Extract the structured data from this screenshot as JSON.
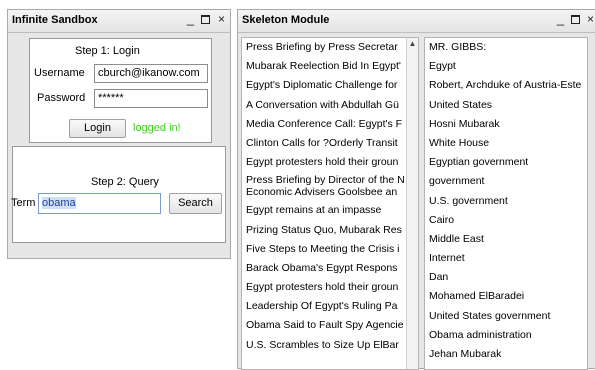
{
  "sandbox": {
    "title": "Infinite Sandbox",
    "min_glyph": "_",
    "close_glyph": "×",
    "step1_title": "Step 1: Login",
    "username_label": "Username",
    "username_value": "cburch@ikanow.com",
    "password_label": "Password",
    "password_value": "******",
    "login_label": "Login",
    "status_text": "logged in!",
    "status_color": "#44cc22",
    "step2_title": "Step 2: Query",
    "term_label": "Term",
    "term_value": "obama",
    "search_label": "Search"
  },
  "skeleton": {
    "title": "Skeleton Module",
    "min_glyph": "_",
    "close_glyph": "×",
    "scroll_up_glyph": "▲",
    "documents": [
      "Press Briefing by Press Secretar",
      "Mubarak Reelection Bid In Egypt'",
      "Egypt's Diplomatic Challenge for",
      "A Conversation with Abdullah Gü",
      "Media Conference Call: Egypt's F",
      "Clinton Calls for ?Orderly Transit",
      "Egypt protesters hold their groun",
      "Press Briefing by Director of the N Economic Advisers Goolsbee an",
      "Egypt remains at an impasse",
      "Prizing Status Quo, Mubarak Res",
      "Five Steps to Meeting the Crisis i",
      "Barack Obama's Egypt Respons",
      "Egypt protesters hold their groun",
      "Leadership Of Egypt's Ruling Pa",
      "Obama Said to Fault Spy Agencie",
      "U.S. Scrambles to Size Up ElBar"
    ],
    "entities": [
      "MR. GIBBS:",
      "Egypt",
      "Robert, Archduke of Austria-Este",
      "United States",
      "Hosni Mubarak",
      "White House",
      "Egyptian government",
      "government",
      "U.S. government",
      "Cairo",
      "Middle East",
      "Internet",
      "Dan",
      "Mohamed ElBaradei",
      "United States government",
      "Obama administration",
      "Jehan Mubarak"
    ]
  }
}
